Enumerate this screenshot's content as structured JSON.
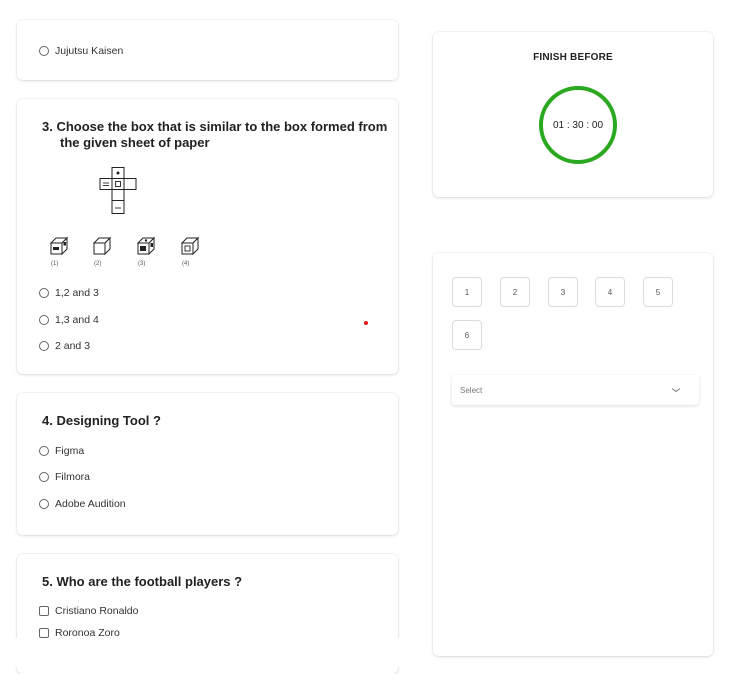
{
  "q2": {
    "last_option": "Jujutsu Kaisen"
  },
  "q3": {
    "title_line1": "3. Choose the box that is similar to the box formed from",
    "title_line2": "the given sheet of paper",
    "figure_labels": [
      "(1)",
      "(2)",
      "(3)",
      "(4)"
    ],
    "options": [
      "1,2 and 3",
      "1,3 and 4",
      "2 and 3"
    ]
  },
  "q4": {
    "title": "4. Designing Tool ?",
    "options": [
      "Figma",
      "Filmora",
      "Adobe Audition"
    ]
  },
  "q5": {
    "title": "5. Who are the football players ?",
    "options": [
      "Cristiano Ronaldo",
      "Roronoa Zoro"
    ]
  },
  "timer": {
    "label": "FINISH BEFORE",
    "time": "01 : 30 : 00",
    "ring_color": "#2aa81f"
  },
  "navigator": {
    "numbers": [
      "1",
      "2",
      "3",
      "4",
      "5",
      "6"
    ],
    "select_placeholder": "Select"
  }
}
